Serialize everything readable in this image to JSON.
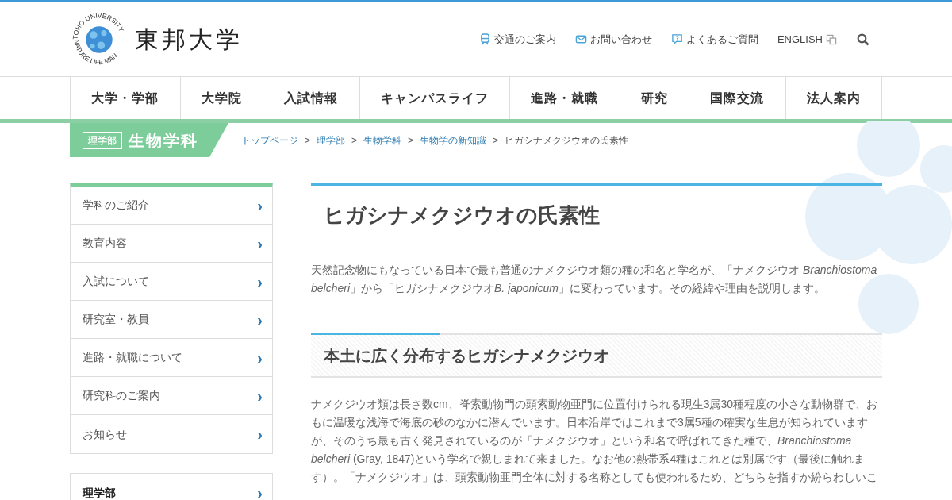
{
  "header": {
    "logo": {
      "ring_top": "TOHO UNIVERSITY",
      "ring_bottom": "NATURE LIFE MAN",
      "name": "東邦大学"
    },
    "utility_links": [
      {
        "label": "交通のご案内"
      },
      {
        "label": "お問い合わせ"
      },
      {
        "label": "よくあるご質問"
      },
      {
        "label": "ENGLISH"
      }
    ]
  },
  "main_nav": [
    {
      "label": "大学・学部"
    },
    {
      "label": "大学院"
    },
    {
      "label": "入試情報"
    },
    {
      "label": "キャンパスライフ"
    },
    {
      "label": "進路・就職"
    },
    {
      "label": "研究"
    },
    {
      "label": "国際交流"
    },
    {
      "label": "法人案内"
    }
  ],
  "section_banner": {
    "faculty": "理学部",
    "department": "生物学科"
  },
  "breadcrumb": [
    {
      "label": "トップページ",
      "link": true
    },
    {
      "label": "理学部",
      "link": true
    },
    {
      "label": "生物学科",
      "link": true
    },
    {
      "label": "生物学の新知識",
      "link": true
    },
    {
      "label": "ヒガシナメクジウオの氏素性",
      "link": false
    }
  ],
  "breadcrumb_separator": ">",
  "sidebar": {
    "menu": [
      {
        "label": "学科のご紹介"
      },
      {
        "label": "教育内容"
      },
      {
        "label": "入試について"
      },
      {
        "label": "研究室・教員"
      },
      {
        "label": "進路・就職について"
      },
      {
        "label": "研究科のご案内"
      },
      {
        "label": "お知らせ"
      }
    ],
    "parent_menu": [
      {
        "label": "理学部"
      }
    ],
    "chevron": "›"
  },
  "article": {
    "title": "ヒガシナメクジウオの氏素性",
    "intro": [
      {
        "text": "天然記念物にもなっている日本で最も普通のナメクジウオ類の種の和名と学名が、「ナメクジウオ ",
        "italic": false
      },
      {
        "text": "Branchiostoma belcheri",
        "italic": true
      },
      {
        "text": "」から「ヒガシナメクジウオ",
        "italic": false
      },
      {
        "text": "B. japonicum",
        "italic": true
      },
      {
        "text": "」に変わっています。その経緯や理由を説明します。",
        "italic": false
      }
    ],
    "sections": [
      {
        "heading": "本土に広く分布するヒガシナメクジウオ",
        "body": "ナメクジウオ類は長さ数cm、脊索動物門の頭索動物亜門に位置付けられる現生3属30種程度の小さな動物群で、おもに温暖な浅海で海底の砂のなかに潜んでいます。日本沿岸ではこれまで3属5種の確実な生息が知られていますが、そのうち最も古く発見されているのが「ナメクジウオ」という和名で呼ばれてきた種で、*Branchiostoma belcheri* (Gray, 1847)という学名で親しまれて来ました。なお他の熱帯系4種はこれとは別属です（最後に触れます）。「ナメクジウオ」は、頭索動物亜門全体に対する名称としても使われるため、どちらを指すか紛らわしいこ"
      }
    ]
  }
}
